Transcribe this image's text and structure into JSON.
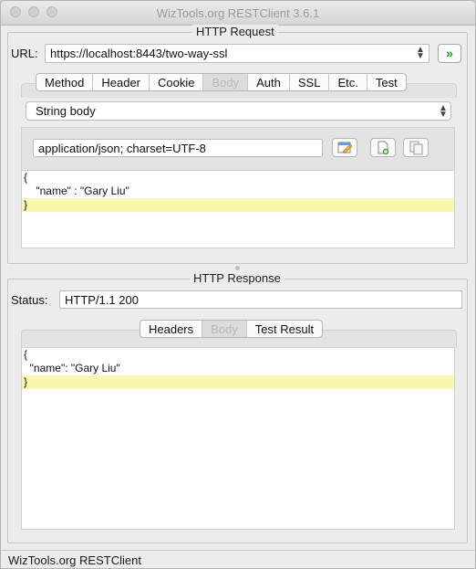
{
  "window": {
    "title": "WizTools.org RESTClient 3.6.1"
  },
  "request": {
    "legend": "HTTP Request",
    "url_label": "URL:",
    "url_value": "https://localhost:8443/two-way-ssl",
    "tabs": [
      {
        "label": "Method",
        "enabled": true
      },
      {
        "label": "Header",
        "enabled": true
      },
      {
        "label": "Cookie",
        "enabled": true
      },
      {
        "label": "Body",
        "enabled": false
      },
      {
        "label": "Auth",
        "enabled": true
      },
      {
        "label": "SSL",
        "enabled": true
      },
      {
        "label": "Etc.",
        "enabled": true
      },
      {
        "label": "Test",
        "enabled": true
      }
    ],
    "body_type": "String body",
    "content_type": "application/json; charset=UTF-8",
    "body_lines": [
      "{",
      "    \"name\" : \"Gary Liu\"",
      "}"
    ]
  },
  "response": {
    "legend": "HTTP Response",
    "status_label": "Status:",
    "status_value": "HTTP/1.1 200",
    "tabs": [
      {
        "label": "Headers",
        "enabled": true
      },
      {
        "label": "Body",
        "enabled": false
      },
      {
        "label": "Test Result",
        "enabled": true
      }
    ],
    "body_lines": [
      "{",
      "  \"name\": \"Gary Liu\"",
      "}"
    ]
  },
  "statusbar": {
    "text": "WizTools.org RESTClient"
  },
  "colors": {
    "go_green": "#1fa51f",
    "highlight_line": "#fbf7b0"
  },
  "icons": {
    "go": "double-chevron-right-icon",
    "edit": "edit-icon",
    "load_file": "load-file-icon",
    "copy": "copy-icon"
  }
}
